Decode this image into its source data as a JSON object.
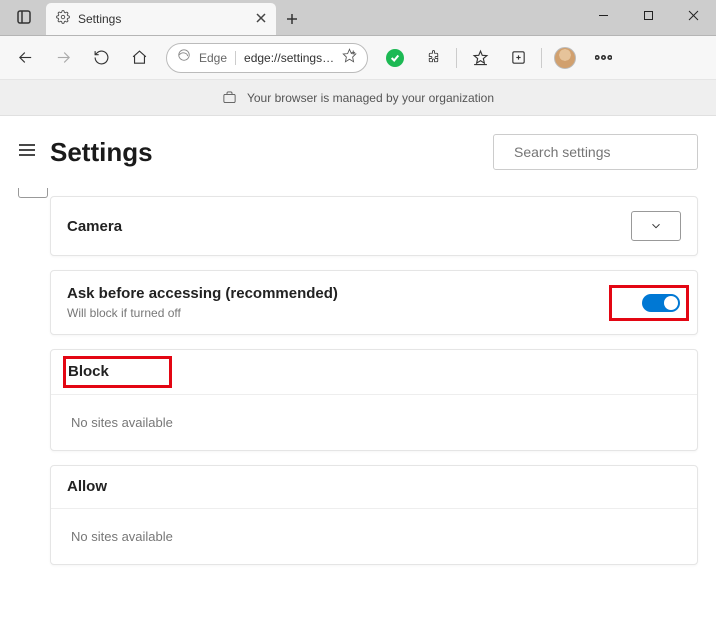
{
  "titlebar": {
    "tab_title": "Settings"
  },
  "toolbar": {
    "omnibox_label": "Edge",
    "omnibox_url": "edge://settings…"
  },
  "banner": {
    "text": "Your browser is managed by your organization"
  },
  "header": {
    "title": "Settings",
    "search_placeholder": "Search settings"
  },
  "camera_card": {
    "title": "Camera"
  },
  "ask_card": {
    "title": "Ask before accessing (recommended)",
    "subtitle": "Will block if turned off",
    "toggle_on": true
  },
  "block_section": {
    "title": "Block",
    "body": "No sites available"
  },
  "allow_section": {
    "title": "Allow",
    "body": "No sites available"
  }
}
